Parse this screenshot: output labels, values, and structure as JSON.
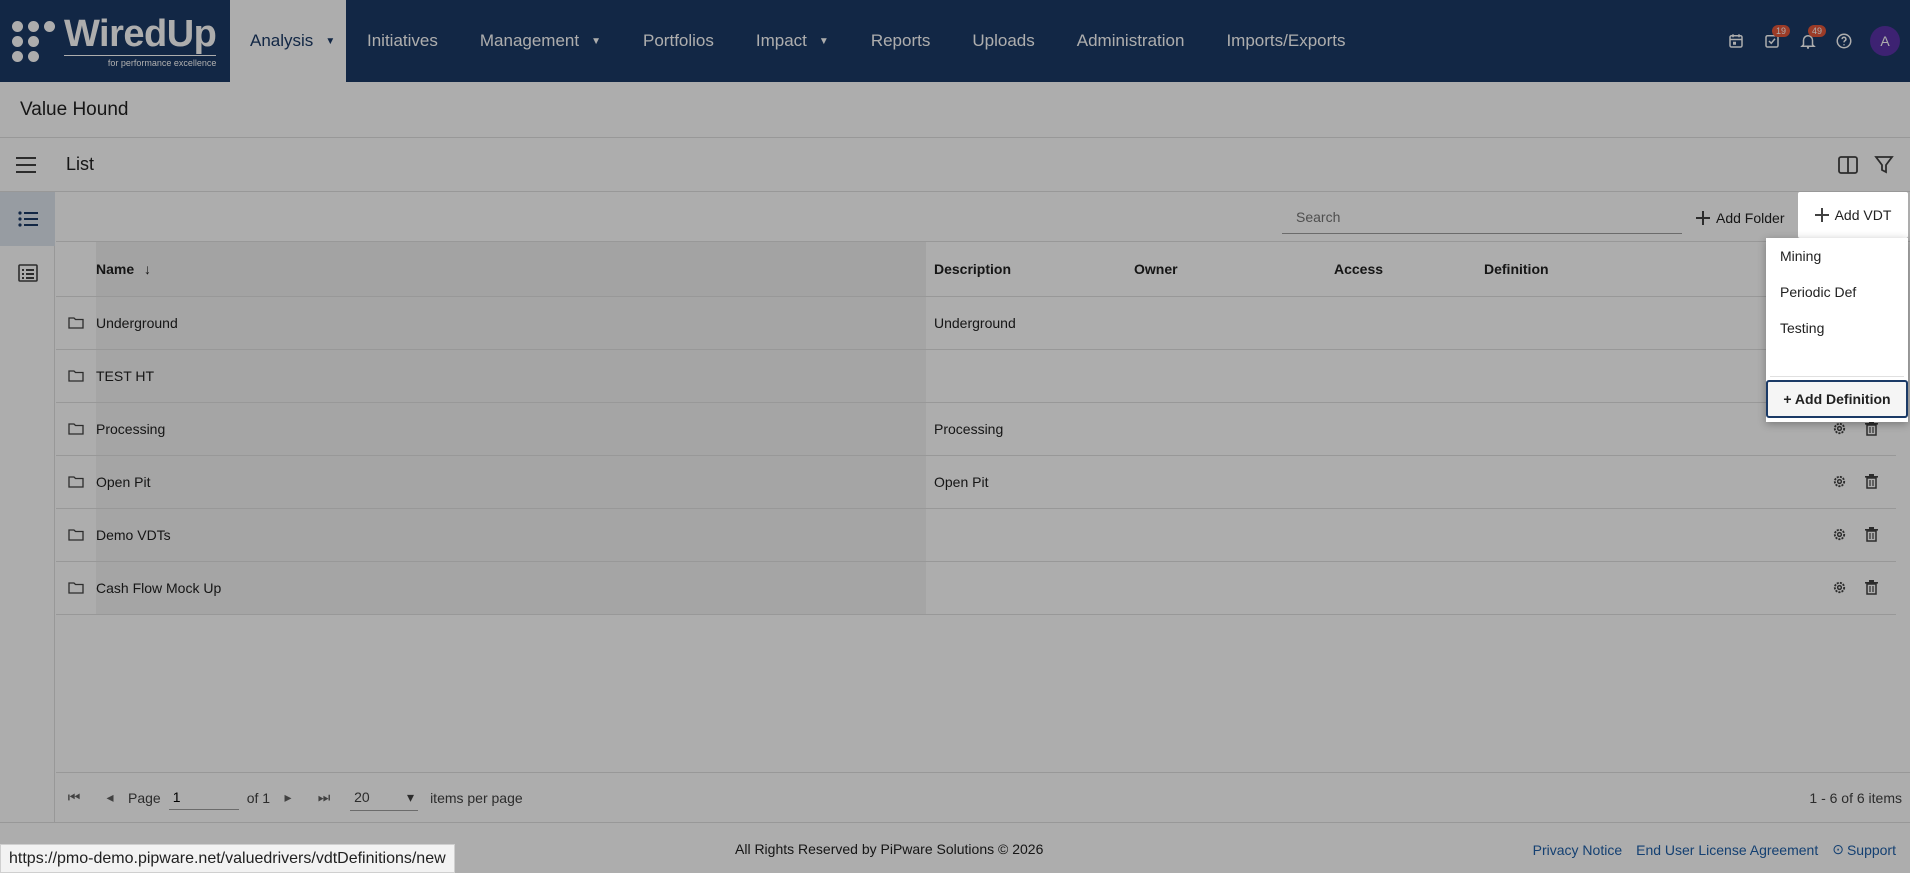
{
  "brand": {
    "logo_word": "WiredUp",
    "logo_tagline": "for performance excellence"
  },
  "nav": {
    "items": [
      {
        "label": "Analysis",
        "dropdown": true,
        "active": true
      },
      {
        "label": "Initiatives",
        "dropdown": false
      },
      {
        "label": "Management",
        "dropdown": true
      },
      {
        "label": "Portfolios",
        "dropdown": false
      },
      {
        "label": "Impact",
        "dropdown": true
      },
      {
        "label": "Reports",
        "dropdown": false
      },
      {
        "label": "Uploads",
        "dropdown": false
      },
      {
        "label": "Administration",
        "dropdown": false
      },
      {
        "label": "Imports/Exports",
        "dropdown": false
      }
    ],
    "tasks_badge": "19",
    "notifications_badge": "49",
    "avatar_initial": "A"
  },
  "page": {
    "title": "Value Hound"
  },
  "toolbar": {
    "list_label": "List"
  },
  "actions": {
    "search_placeholder": "Search",
    "add_folder_label": "Add Folder",
    "add_vdt_label": "Add VDT"
  },
  "table": {
    "headers": {
      "name": "Name",
      "description": "Description",
      "owner": "Owner",
      "access": "Access",
      "definition": "Definition"
    },
    "rows": [
      {
        "name": "Underground",
        "description": "Underground"
      },
      {
        "name": "TEST HT",
        "description": ""
      },
      {
        "name": "Processing",
        "description": "Processing"
      },
      {
        "name": "Open Pit",
        "description": "Open Pit"
      },
      {
        "name": "Demo VDTs",
        "description": ""
      },
      {
        "name": "Cash Flow Mock Up",
        "description": ""
      }
    ]
  },
  "dropdown": {
    "items": [
      "Mining",
      "Periodic Def",
      "Testing"
    ],
    "add_definition_label": "+ Add Definition"
  },
  "pager": {
    "page_label": "Page",
    "page_value": "1",
    "of_label": "of 1",
    "page_size": "20",
    "items_per_page_label": "items per page",
    "range_label": "1 - 6 of 6 items"
  },
  "footer": {
    "copyright": "All Rights Reserved by PiPware Solutions © 2026",
    "privacy": "Privacy Notice",
    "eula": "End User License Agreement",
    "support": "Support"
  },
  "statusbar": {
    "url": "https://pmo-demo.pipware.net/valuedrivers/vdtDefinitions/new"
  },
  "colors": {
    "nav_bg": "#1b3a66",
    "badge": "#e5573a",
    "avatar": "#5a33a8",
    "link": "#1e5fa8"
  }
}
